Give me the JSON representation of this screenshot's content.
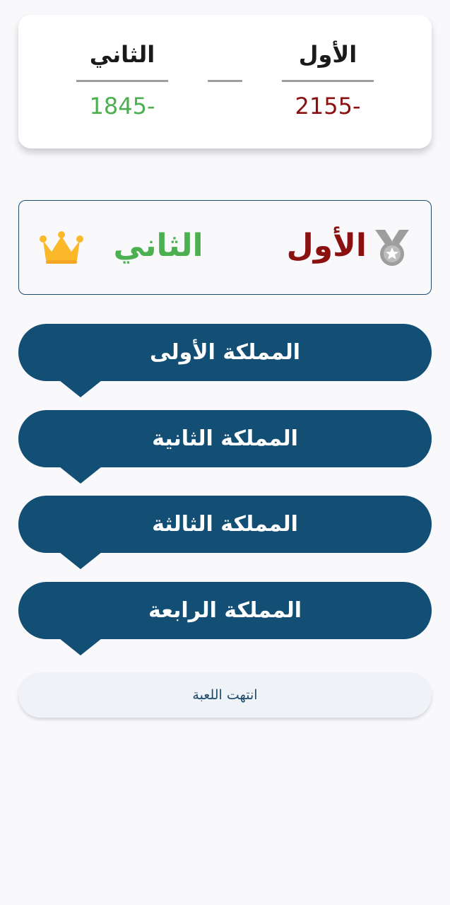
{
  "scoreboard": {
    "team_first": {
      "name": "الأول",
      "score": "2155-"
    },
    "team_second": {
      "name": "الثاني",
      "score": "1845-"
    }
  },
  "winner_banner": {
    "first_label": "الأول",
    "second_label": "الثاني",
    "first_icon": "medal-icon",
    "second_icon": "crown-icon"
  },
  "kingdoms": [
    {
      "label": "المملكة الأولى"
    },
    {
      "label": "المملكة الثانية"
    },
    {
      "label": "المملكة الثالثة"
    },
    {
      "label": "المملكة الرابعة"
    }
  ],
  "end_game": {
    "label": "انتهت اللعبة"
  },
  "colors": {
    "primary": "#134e75",
    "first_team": "#8b1111",
    "second_team": "#4caf50",
    "crown": "#fbb829",
    "medal": "#9e9e9e"
  }
}
